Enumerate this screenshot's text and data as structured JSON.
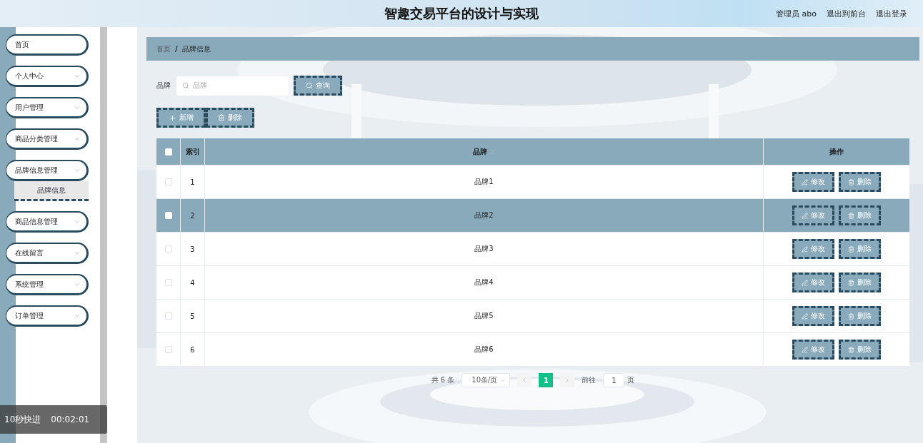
{
  "header": {
    "title": "智趣交易平台的设计与实现",
    "links": [
      "管理员 abo",
      "退出到前台",
      "退出登录"
    ]
  },
  "sidebar": {
    "items": [
      {
        "label": "首页",
        "kind": "link"
      },
      {
        "label": "个人中心",
        "kind": "menu"
      },
      {
        "label": "用户管理",
        "kind": "menu"
      },
      {
        "label": "商品分类管理",
        "kind": "menu"
      },
      {
        "label": "品牌信息管理",
        "kind": "menu",
        "expanded": true,
        "children": [
          {
            "label": "品牌信息",
            "selected": true
          }
        ]
      },
      {
        "label": "商品信息管理",
        "kind": "menu"
      },
      {
        "label": "在线留言",
        "kind": "menu"
      },
      {
        "label": "系统管理",
        "kind": "menu"
      },
      {
        "label": "订单管理",
        "kind": "menu"
      }
    ]
  },
  "breadcrumb": [
    "首页",
    "/",
    "品牌信息"
  ],
  "search": {
    "label": "品牌",
    "placeholder": "品牌",
    "button": "查询"
  },
  "actions": [
    "新增",
    "删除"
  ],
  "table": {
    "columns": [
      "索引",
      "品牌",
      "操作"
    ],
    "all_checked": false,
    "rows": [
      {
        "index": "1",
        "brand": "品牌1",
        "checked": false,
        "hovered": false,
        "actions": [
          "修改",
          "删除"
        ]
      },
      {
        "index": "2",
        "brand": "品牌2",
        "checked": false,
        "hovered": true,
        "actions": [
          "修改",
          "删除"
        ]
      },
      {
        "index": "3",
        "brand": "品牌3",
        "checked": false,
        "hovered": false,
        "actions": [
          "修改",
          "删除"
        ]
      },
      {
        "index": "4",
        "brand": "品牌4",
        "checked": false,
        "hovered": false,
        "actions": [
          "修改",
          "删除"
        ]
      },
      {
        "index": "5",
        "brand": "品牌5",
        "checked": false,
        "hovered": false,
        "actions": [
          "修改",
          "删除"
        ]
      },
      {
        "index": "6",
        "brand": "品牌6",
        "checked": false,
        "hovered": false,
        "actions": [
          "修改",
          "删除"
        ]
      }
    ]
  },
  "pagination": {
    "total": "共 6 条",
    "page_size": "10条/页",
    "pages": [
      {
        "label": "1",
        "selected": true
      }
    ],
    "goto_label": "前往",
    "goto_value": "1",
    "page_suffix": "页"
  },
  "video_overlay": {
    "label": "10秒快进",
    "time": "00:02:01"
  }
}
